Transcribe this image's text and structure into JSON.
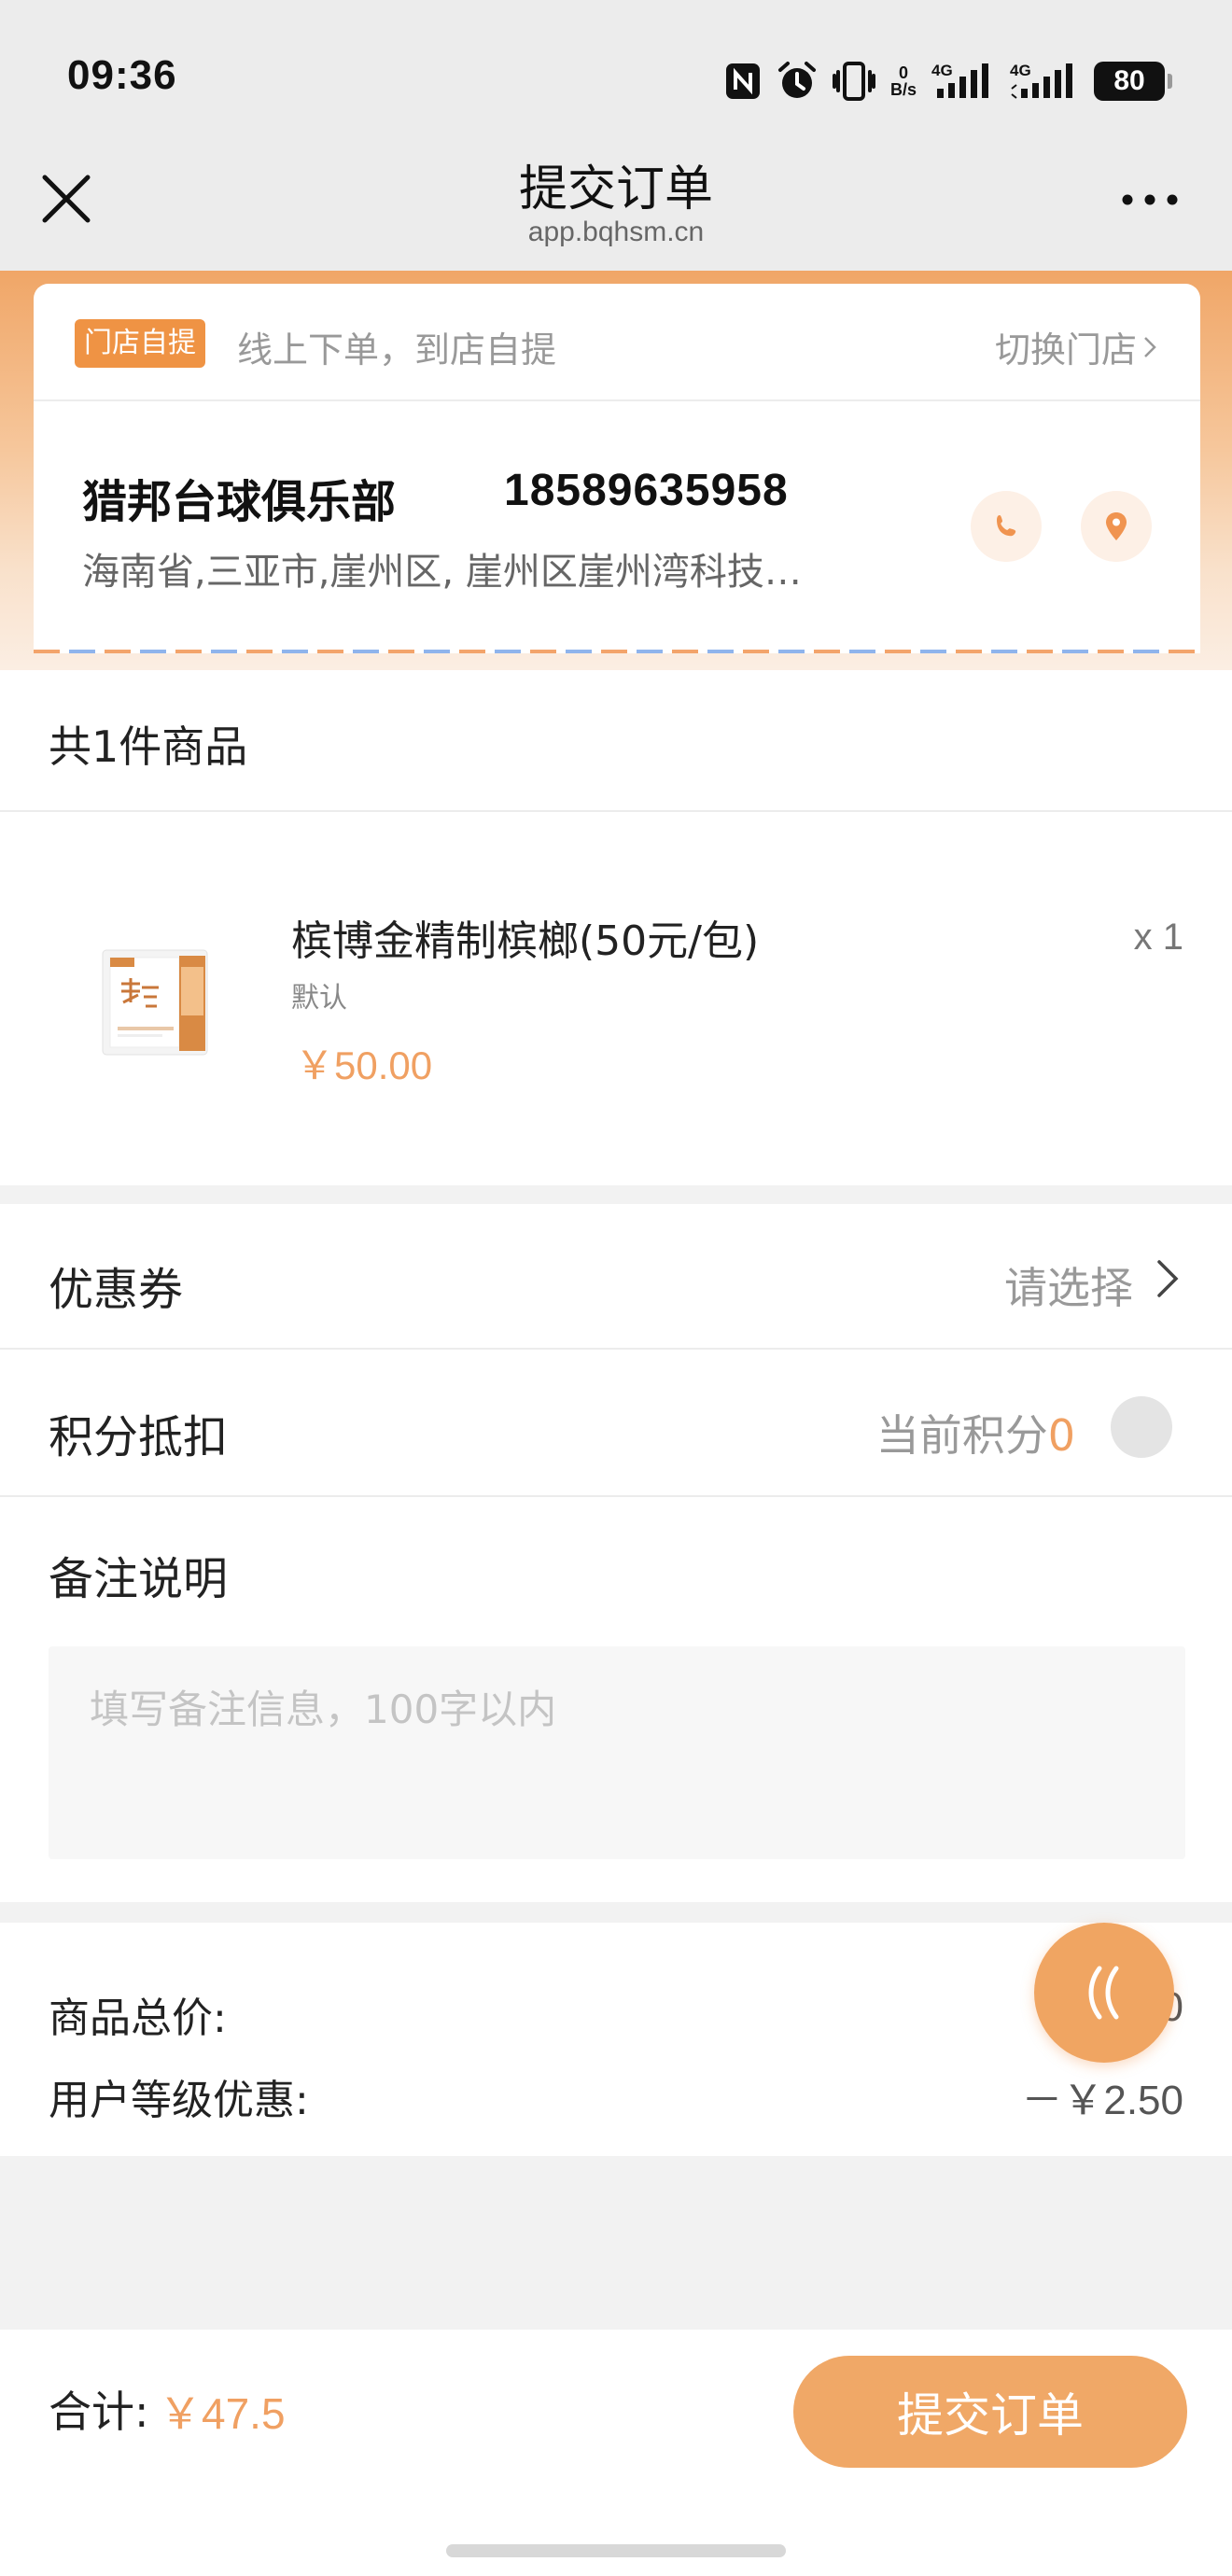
{
  "status_bar": {
    "time": "09:36",
    "net_speed_value": "0",
    "net_speed_unit": "B/s",
    "signal1_label": "4G",
    "signal2_label": "4G",
    "battery": "80"
  },
  "nav": {
    "title": "提交订单",
    "subtitle": "app.bqhsm.cn"
  },
  "store": {
    "pickup_badge": "门店自提",
    "pickup_desc": "线上下单，到店自提",
    "switch_label": "切换门店",
    "name": "猎邦台球俱乐部",
    "phone": "18589635958",
    "address": "海南省,三亚市,崖州区, 崖州区崖州湾科技…"
  },
  "goods": {
    "count_label": "共1件商品",
    "items": [
      {
        "name": "槟博金精制槟榔(50元/包)",
        "spec": "默认",
        "price": "￥50.00",
        "qty": "x 1"
      }
    ]
  },
  "options": {
    "coupon_label": "优惠券",
    "coupon_value": "请选择",
    "points_label": "积分抵扣",
    "points_prefix": "当前积分",
    "points_value": "0",
    "points_enabled": false,
    "remark_label": "备注说明",
    "remark_placeholder": "填写备注信息，100字以内",
    "remark_value": ""
  },
  "totals": {
    "goods_total_label": "商品总价:",
    "goods_total_value": "0",
    "member_discount_label": "用户等级优惠:",
    "member_discount_value": "－￥2.50"
  },
  "footer": {
    "sum_label": "合计:",
    "sum_value": "￥47.5",
    "submit_label": "提交订单"
  },
  "colors": {
    "accent": "#f0a062",
    "badge": "#ef9344",
    "button": "#f0a867"
  }
}
